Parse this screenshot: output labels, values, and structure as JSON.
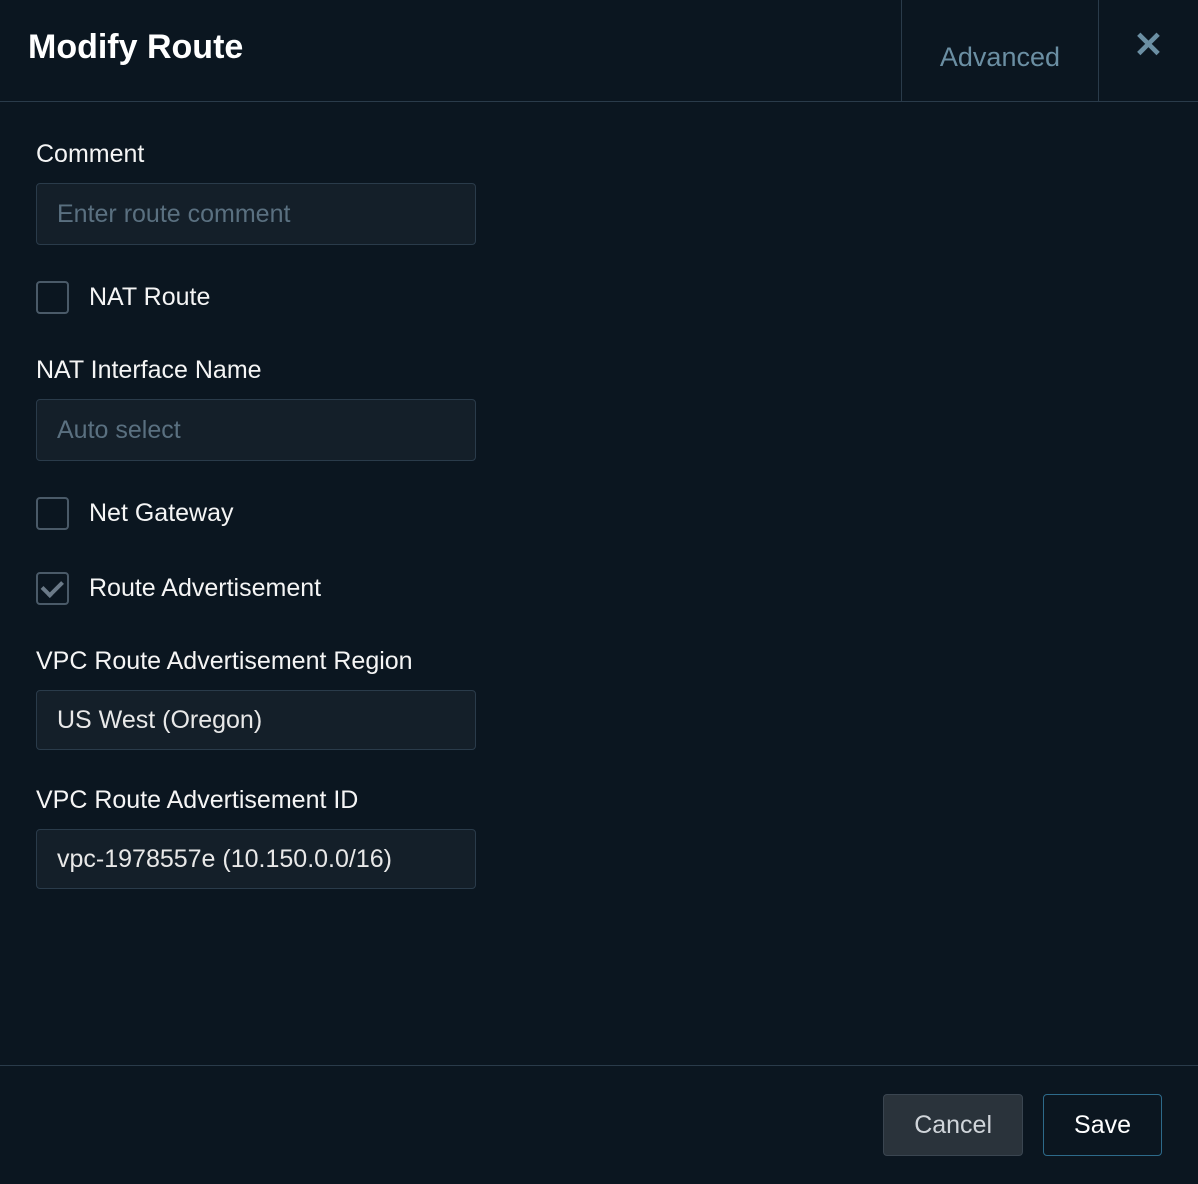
{
  "header": {
    "title": "Modify Route",
    "advanced_tab": "Advanced"
  },
  "form": {
    "comment": {
      "label": "Comment",
      "placeholder": "Enter route comment",
      "value": ""
    },
    "nat_route": {
      "label": "NAT Route",
      "checked": false
    },
    "nat_interface": {
      "label": "NAT Interface Name",
      "placeholder": "Auto select",
      "value": ""
    },
    "net_gateway": {
      "label": "Net Gateway",
      "checked": false
    },
    "route_advertisement": {
      "label": "Route Advertisement",
      "checked": true
    },
    "vpc_region": {
      "label": "VPC Route Advertisement Region",
      "value": "US West (Oregon)"
    },
    "vpc_id": {
      "label": "VPC Route Advertisement ID",
      "value": "vpc-1978557e (10.150.0.0/16)"
    }
  },
  "footer": {
    "cancel": "Cancel",
    "save": "Save"
  }
}
